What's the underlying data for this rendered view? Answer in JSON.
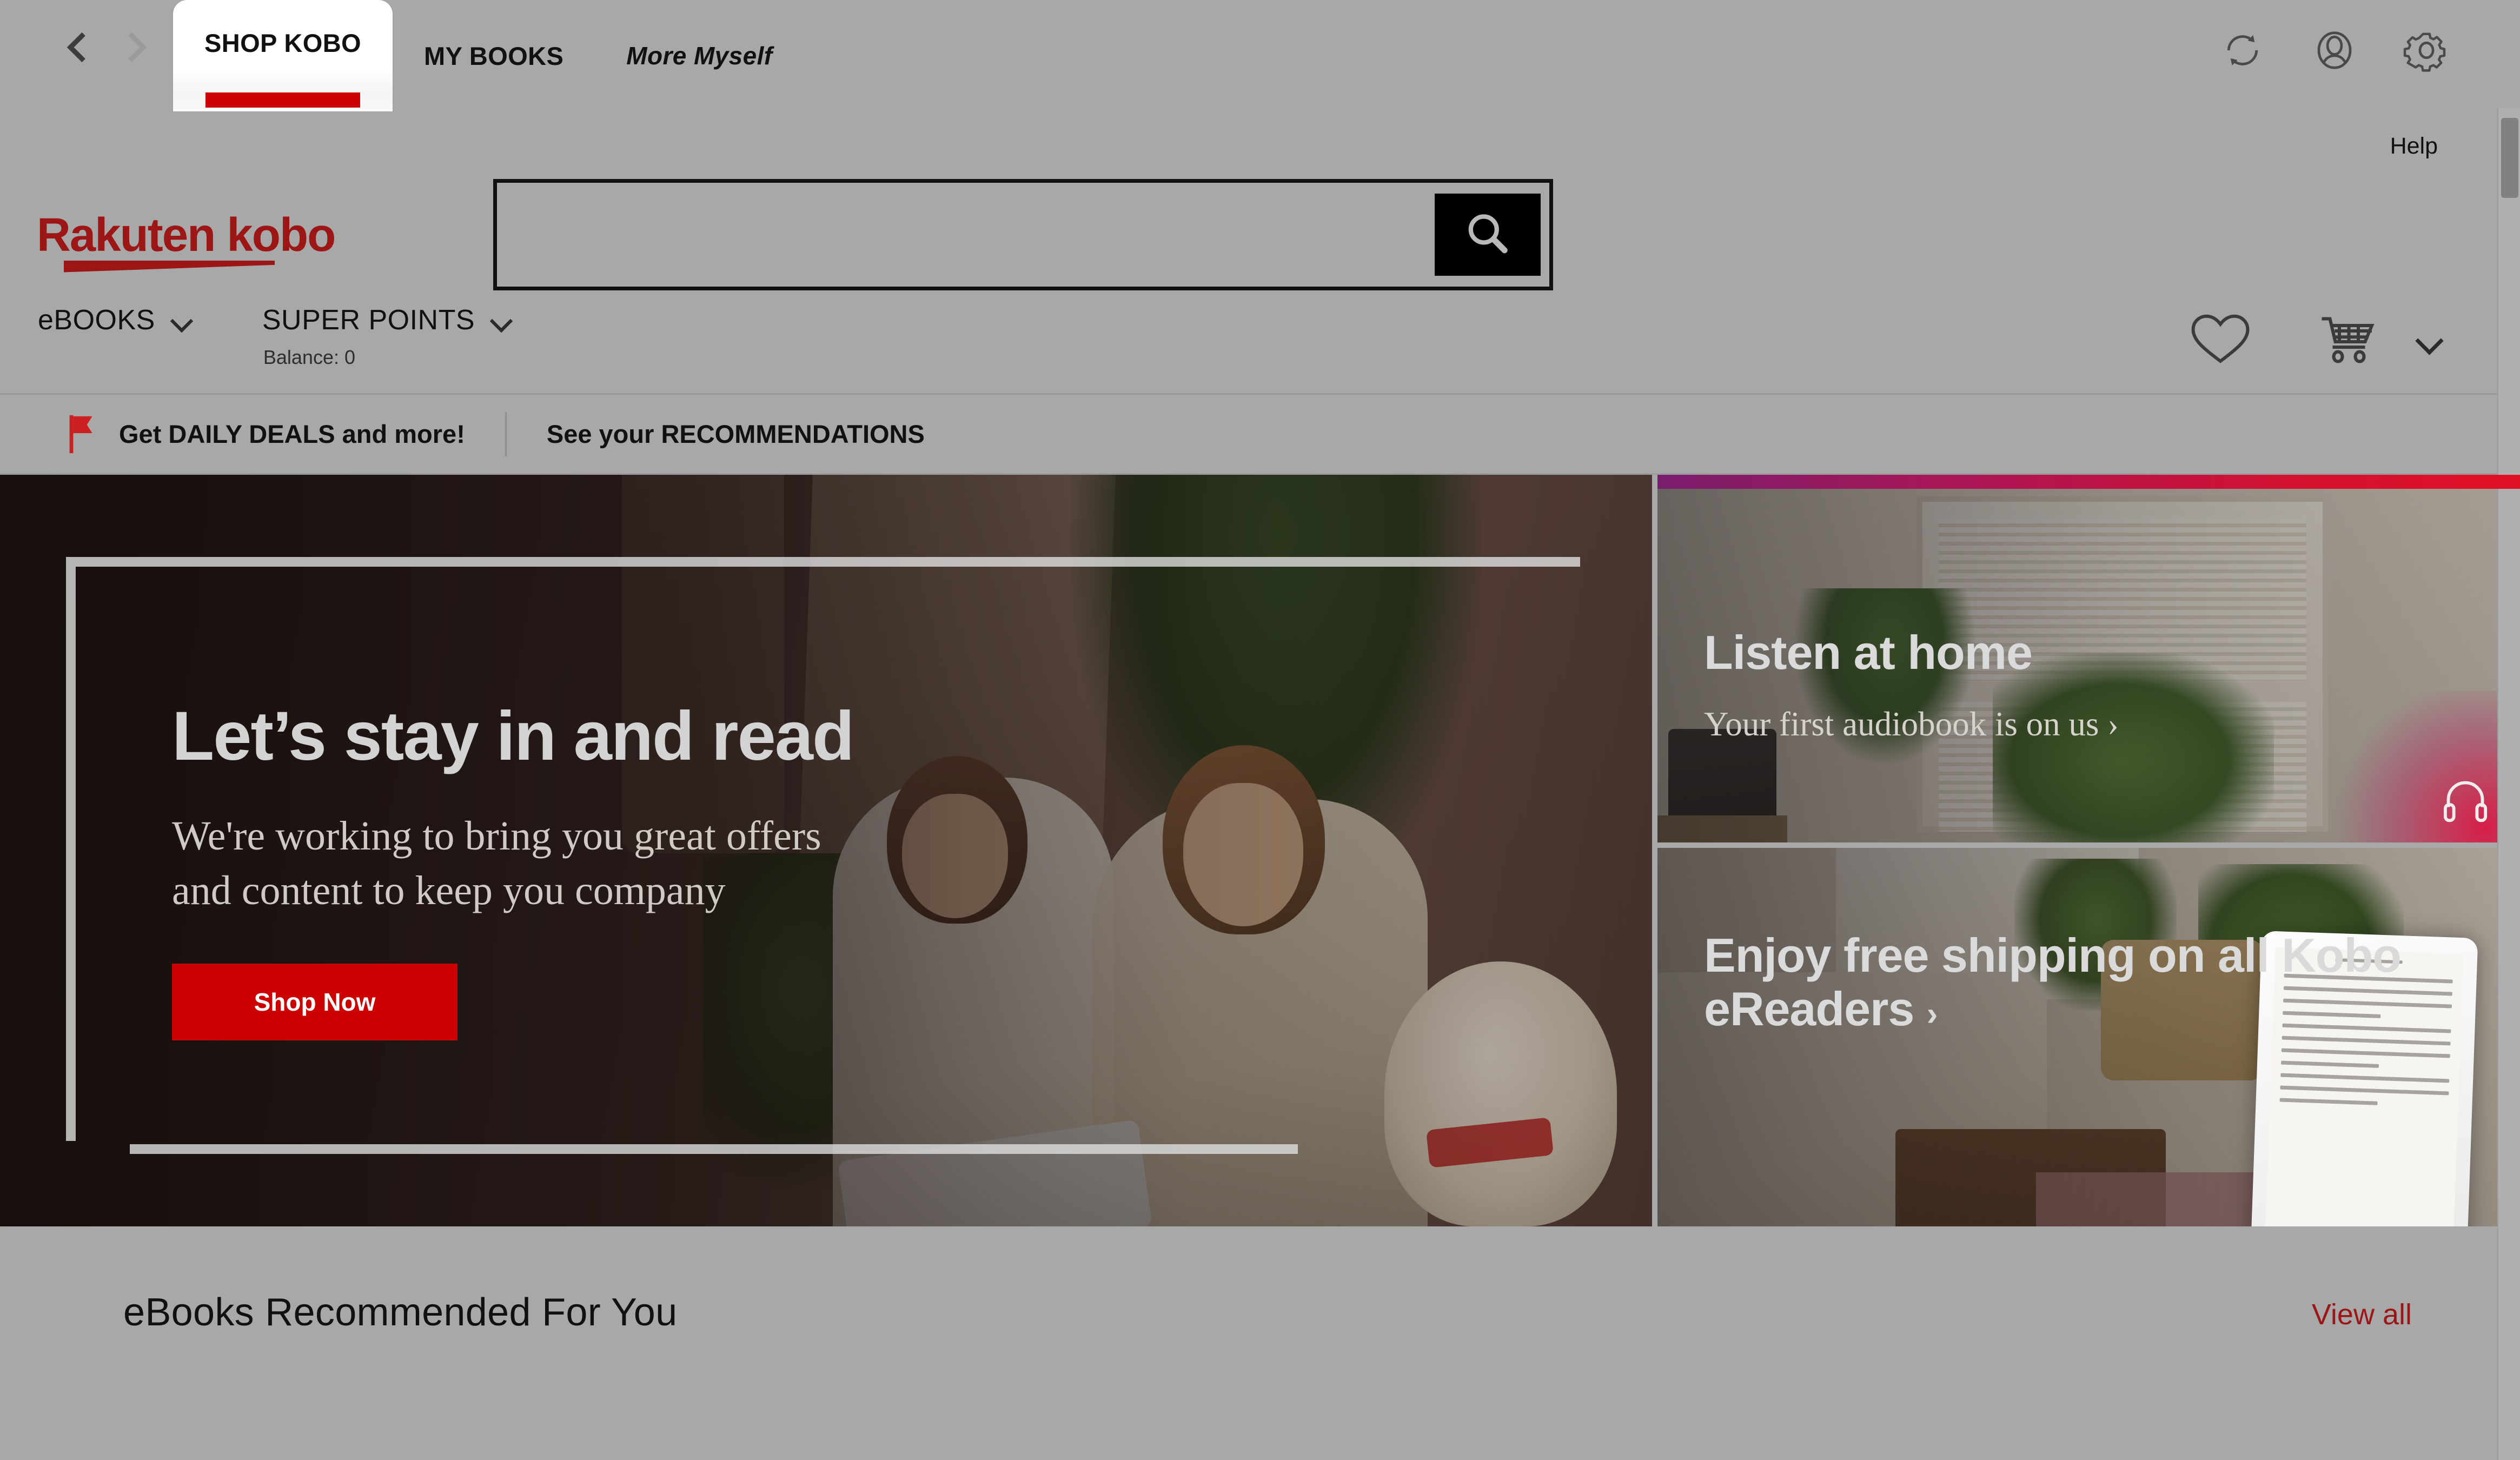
{
  "appbar": {
    "back_icon": "chevron-left-icon",
    "forward_icon": "chevron-right-icon",
    "tabs": [
      {
        "label": "SHOP KOBO",
        "active": true
      },
      {
        "label": "MY BOOKS",
        "active": false
      },
      {
        "label": "More Myself",
        "active": false,
        "italic": true
      }
    ],
    "icons": [
      "sync-icon",
      "account-icon",
      "settings-gear-icon"
    ]
  },
  "header": {
    "help_label": "Help",
    "logo_text": "Rakuten kobo",
    "search": {
      "value": "",
      "placeholder": "",
      "button_icon": "search-icon"
    }
  },
  "categories": {
    "ebooks_label": "eBOOKS",
    "super_points_label": "SUPER POINTS",
    "balance_label": "Balance: 0",
    "wishlist_icon": "heart-icon",
    "cart_icon": "shopping-cart-icon",
    "cart_caret_icon": "chevron-down-icon"
  },
  "deals": {
    "flag_icon": "flag-icon",
    "daily_deals_label": "Get DAILY DEALS and more!",
    "recommendations_label": "See your RECOMMENDATIONS"
  },
  "hero": {
    "headline": "Let’s stay in and read",
    "subtext": "We're working to bring you great offers and content to keep you company",
    "cta_label": "Shop Now"
  },
  "promos": [
    {
      "title": "Listen at home",
      "subtitle": "Your first audiobook is on us",
      "arrow": "›",
      "icon": "headphones-icon"
    },
    {
      "title": "Enjoy free shipping on all Kobo eReaders",
      "subtitle": "",
      "arrow": "›",
      "icon": "ereader-device-icon"
    }
  ],
  "recommended": {
    "title": "eBooks Recommended For You",
    "view_all_label": "View all"
  },
  "colors": {
    "brand_red": "#cc0000",
    "logo_red": "#9c1616",
    "page_bg": "#a8a8a8",
    "link_red": "#9c1616"
  }
}
